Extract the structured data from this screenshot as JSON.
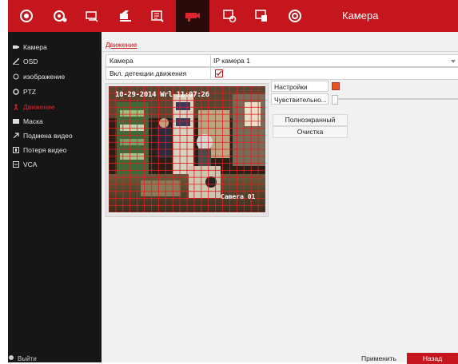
{
  "header": {
    "title": "Камера",
    "icons": [
      "live-view-icon",
      "playback-icon",
      "cloud-icon",
      "record-icon",
      "storage-icon",
      "camera-icon",
      "network-icon",
      "system-icon",
      "maintenance-icon"
    ],
    "active_icon": "camera-icon"
  },
  "sidebar": {
    "items": [
      {
        "label": "Камера",
        "icon": "camera-icon"
      },
      {
        "label": "OSD",
        "icon": "osd-icon"
      },
      {
        "label": "изображение",
        "icon": "image-icon"
      },
      {
        "label": "PTZ",
        "icon": "ptz-icon"
      },
      {
        "label": "Движение",
        "icon": "motion-icon",
        "active": true
      },
      {
        "label": "Маска",
        "icon": "mask-icon"
      },
      {
        "label": "Подмена видео",
        "icon": "tamper-icon"
      },
      {
        "label": "Потеря видео",
        "icon": "video-loss-icon"
      },
      {
        "label": "VCA",
        "icon": "vca-icon"
      }
    ],
    "exit_label": "Выйти"
  },
  "main": {
    "subtab": "Движение",
    "camera_label": "Камера",
    "camera_value": "IP камера 1",
    "enable_label": "Вкл. детекции движения",
    "enable_checked": true,
    "osd_time": "10-29-2014 Wrl 11:07:26",
    "osd_name": "Camera 01",
    "settings_label": "Настройки",
    "sensitivity_label": "Чувствительно...",
    "sensitivity_level": 0,
    "fullscreen_label": "Полноэкранный",
    "clear_label": "Очистка",
    "apply_label": "Применить",
    "back_label": "Назад"
  },
  "colors": {
    "brand_red": "#c4161c",
    "sidebar_bg": "#161616",
    "settings_swatch": "#e8501e"
  }
}
